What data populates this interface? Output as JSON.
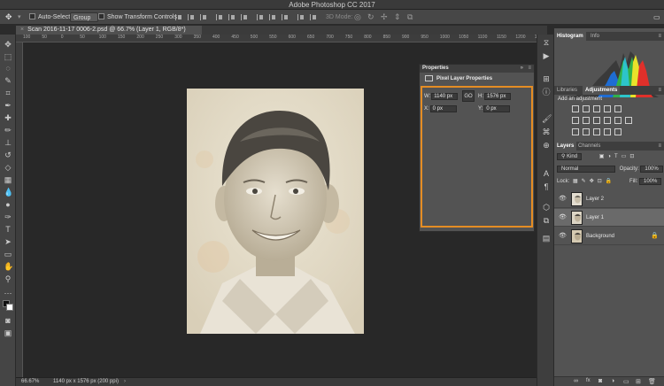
{
  "app": {
    "title": "Adobe Photoshop CC 2017"
  },
  "options_bar": {
    "auto_select_label": "Auto-Select:",
    "auto_select_value": "Group",
    "transform_label": "Show Transform Controls",
    "mode_3d_label": "3D Mode:"
  },
  "document": {
    "tab_title": "Scan 2016-11-17 0006-2.psd @ 66.7% (Layer 1, RGB/8*)",
    "tab_close": "×",
    "zoom": "66.67%",
    "dimensions_info": "1140 px x 1576 px (200 ppi)"
  },
  "ruler": {
    "ticks": [
      "100",
      "50",
      "0",
      "50",
      "100",
      "150",
      "200",
      "250",
      "300",
      "350",
      "400",
      "450",
      "500",
      "550",
      "600",
      "650",
      "700",
      "750",
      "800",
      "850",
      "900",
      "950",
      "1000",
      "1050",
      "1100",
      "1150",
      "1200",
      "1250"
    ]
  },
  "properties": {
    "title": "Properties",
    "section": "Pixel Layer Properties",
    "w_label": "W:",
    "w_value": "1140 px",
    "link_label": "GO",
    "h_label": "H:",
    "h_value": "1576 px",
    "x_label": "X:",
    "x_value": "0 px",
    "y_label": "Y:",
    "y_value": "0 px"
  },
  "histogram_panel": {
    "tab1": "Histogram",
    "tab2": "Info"
  },
  "adjustments_panel": {
    "tab1": "Libraries",
    "tab2": "Adjustments",
    "subtitle": "Add an adjustment"
  },
  "layers_panel": {
    "tab1": "Layers",
    "tab2": "Channels",
    "filter_kind": "Kind",
    "blend_mode": "Normal",
    "opacity_label": "Opacity:",
    "opacity_value": "100%",
    "lock_label": "Lock:",
    "fill_label": "Fill:",
    "fill_value": "100%",
    "layers": [
      {
        "name": "Layer 2",
        "selected": false
      },
      {
        "name": "Layer 1",
        "selected": true
      },
      {
        "name": "Background",
        "selected": false
      }
    ]
  },
  "colors": {
    "accent_orange": "#e58d24",
    "panel": "#535353",
    "canvas": "#282828"
  }
}
